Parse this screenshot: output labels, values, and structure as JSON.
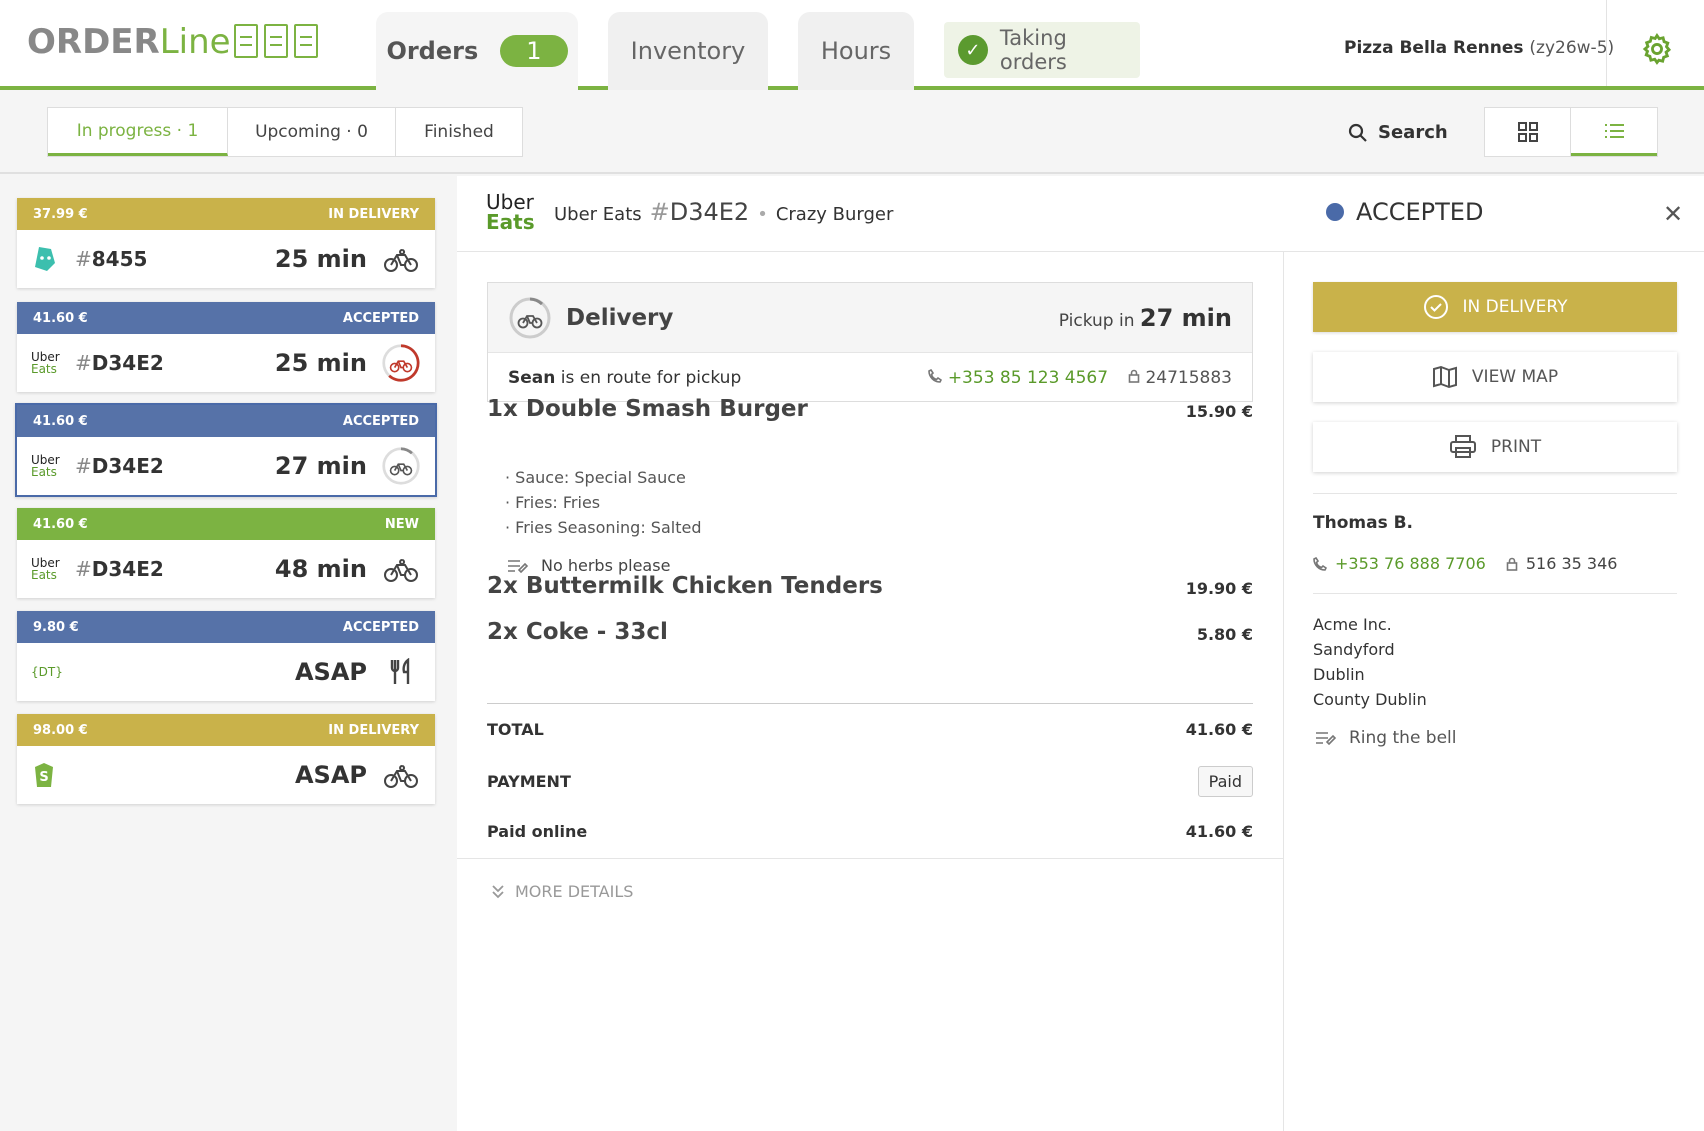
{
  "app": {
    "logo_main": "ORDER",
    "logo_line": "Line"
  },
  "tabs": [
    {
      "label": "Orders",
      "badge": "1"
    },
    {
      "label": "Inventory"
    },
    {
      "label": "Hours"
    }
  ],
  "taking_orders": "Taking orders",
  "restaurant": {
    "name": "Pizza Bella Rennes",
    "code": "(zy26w-5)"
  },
  "filters": [
    {
      "label": "In progress · 1"
    },
    {
      "label": "Upcoming · 0"
    },
    {
      "label": "Finished"
    }
  ],
  "search_label": "Search",
  "colors": {
    "green": "#7cb342",
    "blue": "#5672a8",
    "gold": "#c9b24a",
    "red": "#c0392b"
  },
  "orders": [
    {
      "amount": "37.99 €",
      "status": "IN DELIVERY",
      "status_color": "#c9b24a",
      "platform": "deliveroo-icon",
      "hash": "#",
      "id": "8455",
      "time": "25 min",
      "icon": "bike-icon"
    },
    {
      "amount": "41.60 €",
      "status": "ACCEPTED",
      "status_color": "#5672a8",
      "platform": "uber-eats",
      "hash": "#",
      "id": "D34E2",
      "time": "25 min",
      "icon": "bike-timer-red-icon"
    },
    {
      "amount": "41.60 €",
      "status": "ACCEPTED",
      "status_color": "#5672a8",
      "platform": "uber-eats",
      "hash": "#",
      "id": "D34E2",
      "time": "27 min",
      "icon": "bike-timer-icon"
    },
    {
      "amount": "41.60 €",
      "status": "NEW",
      "status_color": "#7cb342",
      "platform": "uber-eats",
      "hash": "#",
      "id": "D34E2",
      "time": "48 min",
      "icon": "bike-icon"
    },
    {
      "amount": "9.80 €",
      "status": "ACCEPTED",
      "status_color": "#5672a8",
      "platform": "dt",
      "platform_text": "{DT}",
      "hash": "",
      "id": "",
      "time": "ASAP",
      "icon": "fork-knife-icon"
    },
    {
      "amount": "98.00 €",
      "status": "IN DELIVERY",
      "status_color": "#c9b24a",
      "platform": "shopify-icon",
      "hash": "",
      "id": "",
      "time": "ASAP",
      "icon": "bike-icon"
    }
  ],
  "detail": {
    "logo_uber": "Uber",
    "logo_eats": "Eats",
    "platform": "Uber Eats",
    "hash": "#",
    "order_id": "D34E2",
    "store": "Crazy Burger",
    "status": "ACCEPTED",
    "delivery": {
      "label": "Delivery",
      "pickup_label": "Pickup in",
      "pickup_time": "27 min",
      "courier": "Sean",
      "courier_text": "is en route for pickup",
      "phone": "+353 85 123 4567",
      "pin": "24715883"
    },
    "items": [
      {
        "name": "1x Double Smash Burger",
        "price": "15.90 €",
        "modifiers": [
          "· Sauce: Special Sauce",
          "· Fries: Fries",
          "· Fries Seasoning: Salted"
        ],
        "note": "No herbs please"
      },
      {
        "name": "2x Buttermilk Chicken Tenders",
        "price": "19.90 €"
      },
      {
        "name": "2x Coke - 33cl",
        "price": "5.80 €"
      }
    ],
    "total_label": "TOTAL",
    "total": "41.60 €",
    "payment_label": "PAYMENT",
    "payment_status": "Paid",
    "paid_online_label": "Paid online",
    "paid_online": "41.60 €",
    "more_details": "MORE DETAILS"
  },
  "actions": {
    "in_delivery": "IN DELIVERY",
    "view_map": "VIEW MAP",
    "print": "PRINT"
  },
  "customer": {
    "name": "Thomas B.",
    "phone": "+353 76 888 7706",
    "pin": "516 35 346",
    "address": [
      "Acme Inc.",
      "Sandyford",
      "Dublin",
      "County Dublin"
    ],
    "note": "Ring the bell"
  }
}
